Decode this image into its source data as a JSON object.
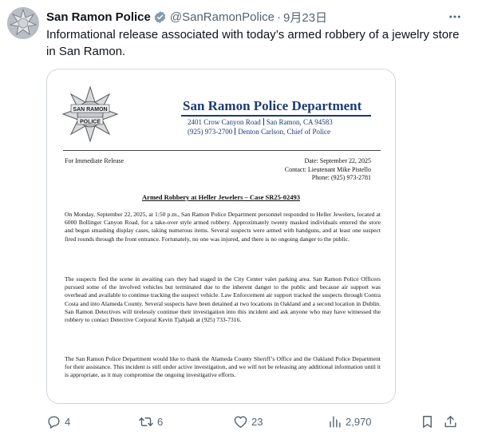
{
  "tweet": {
    "display_name": "San Ramon Police",
    "handle": "@SanRamonPolice",
    "separator": "·",
    "date": "9月23日",
    "text": "Informational release associated with today’s armed robbery of a jewelry store in San Ramon.",
    "verified_icon": "verified-badge-icon",
    "verified_color": "#829aab",
    "more_icon": "more-options-icon"
  },
  "avatar": {
    "badge_text": "SAN RAMON POLICE"
  },
  "document": {
    "badge_text_top": "SAN RAMON",
    "badge_text_bottom": "POLICE",
    "department": "San Ramon Police Department",
    "street": "2401 Crow Canyon Road",
    "city": "San Ramon, CA  94583",
    "phone_main": "(925) 973-2700",
    "chief": "Denton Carlson, Chief of Police",
    "for_release": "For Immediate Release",
    "date_line": "Date: September 22, 2025",
    "contact_line": "Contact: Lieutenant Mike Pistello",
    "contact_phone": "Phone: (925) 973-2781",
    "case_title": "Armed Robbery at Heller Jewelers – Case SR25-02493",
    "paragraph_1": "On Monday, September 22, 2025, at 1:50 p.m., San Ramon Police Department personnel responded to Heller Jewelers, located at 6000 Bollinger Canyon Road, for a take-over style armed robbery. Approximately twenty masked individuals entered the store and began smashing display cases, taking numerous items. Several suspects were armed with handguns, and at least one suspect fired rounds through the front entrance. Fortunately, no one was injured, and there is no ongoing danger to the public.",
    "paragraph_2": "The suspects fled the scene in awaiting cars they had staged in the City Center valet parking area. San Ramon Police Officers pursued some of the involved vehicles but terminated due to the inherent danger to the public and because air support was overhead and available to continue tracking the suspect vehicle. Law Enforcement air support tracked the suspects through Contra Costa and into Alameda County. Several suspects have been detained at two locations in Oakland and a second location in Dublin. San Ramon Detectives will tirelessly continue their investigation into this incident and ask anyone who may have witnessed the robbery to contact Detective Corporal Kevin Tjahjadi at (925) 733-7316.",
    "paragraph_3": "The San Ramon Police Department would like to thank the Alameda County Sheriff’s Office and the Oakland Police Department for their assistance. This incident is still under active investigation, and we will not be releasing any additional information until it is appropriate, as it may compromise the ongoing investigative efforts.",
    "header_color": "#1c3a74"
  },
  "actions": {
    "replies": "4",
    "retweets": "6",
    "likes": "23",
    "views": "2,970",
    "reply_icon": "reply-icon",
    "retweet_icon": "retweet-icon",
    "like_icon": "heart-icon",
    "views_icon": "views-chart-icon",
    "bookmark_icon": "bookmark-icon",
    "share_icon": "share-icon"
  }
}
